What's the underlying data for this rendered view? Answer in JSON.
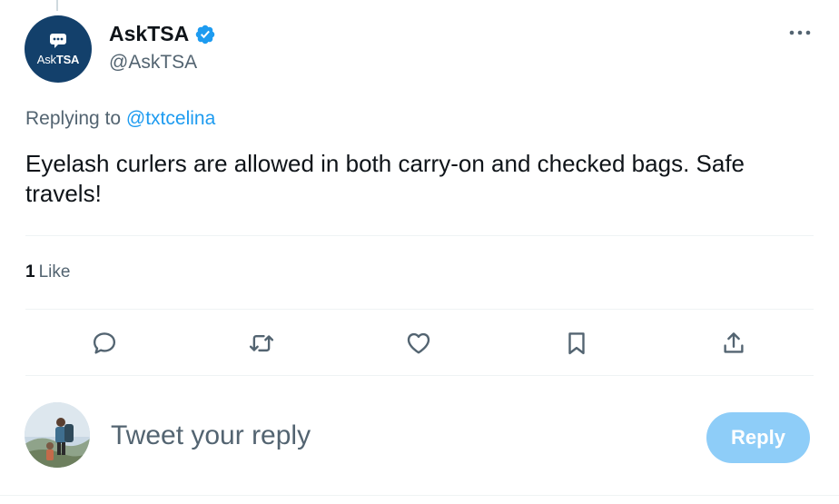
{
  "author": {
    "display_name": "AskTSA",
    "handle": "@AskTSA",
    "verified": true,
    "avatar_text_prefix": "Ask",
    "avatar_text_bold": "TSA"
  },
  "tweet": {
    "replying_to_label": "Replying to",
    "replying_to_handle": "@txtcelina",
    "text": "Eyelash curlers are allowed in both carry-on and checked bags. Safe travels!",
    "like_count": "1",
    "like_label": "Like"
  },
  "actions": [
    {
      "name": "reply",
      "icon": "comment-icon"
    },
    {
      "name": "retweet",
      "icon": "retweet-icon"
    },
    {
      "name": "like",
      "icon": "heart-icon"
    },
    {
      "name": "bookmark",
      "icon": "bookmark-icon"
    },
    {
      "name": "share",
      "icon": "share-icon"
    }
  ],
  "composer": {
    "placeholder": "Tweet your reply",
    "reply_button_label": "Reply"
  },
  "colors": {
    "accent": "#1d9bf0",
    "secondary_text": "#536471",
    "reply_button_disabled": "#8ecdf8",
    "avatar_bg": "#13406b"
  }
}
